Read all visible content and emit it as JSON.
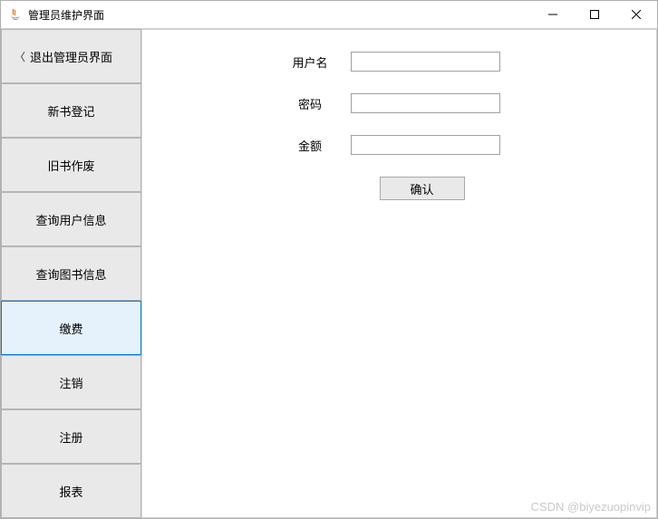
{
  "window": {
    "title": "管理员维护界面"
  },
  "sidebar": {
    "items": [
      {
        "label": "退出管理员界面",
        "has_back": true,
        "selected": false
      },
      {
        "label": "新书登记",
        "has_back": false,
        "selected": false
      },
      {
        "label": "旧书作废",
        "has_back": false,
        "selected": false
      },
      {
        "label": "查询用户信息",
        "has_back": false,
        "selected": false
      },
      {
        "label": "查询图书信息",
        "has_back": false,
        "selected": false
      },
      {
        "label": "缴费",
        "has_back": false,
        "selected": true
      },
      {
        "label": "注销",
        "has_back": false,
        "selected": false
      },
      {
        "label": "注册",
        "has_back": false,
        "selected": false
      },
      {
        "label": "报表",
        "has_back": false,
        "selected": false
      }
    ]
  },
  "form": {
    "username_label": "用户名",
    "username_value": "",
    "password_label": "密码",
    "password_value": "",
    "amount_label": "金额",
    "amount_value": "",
    "confirm_label": "确认"
  },
  "watermark": "CSDN @biyezuopinvip"
}
